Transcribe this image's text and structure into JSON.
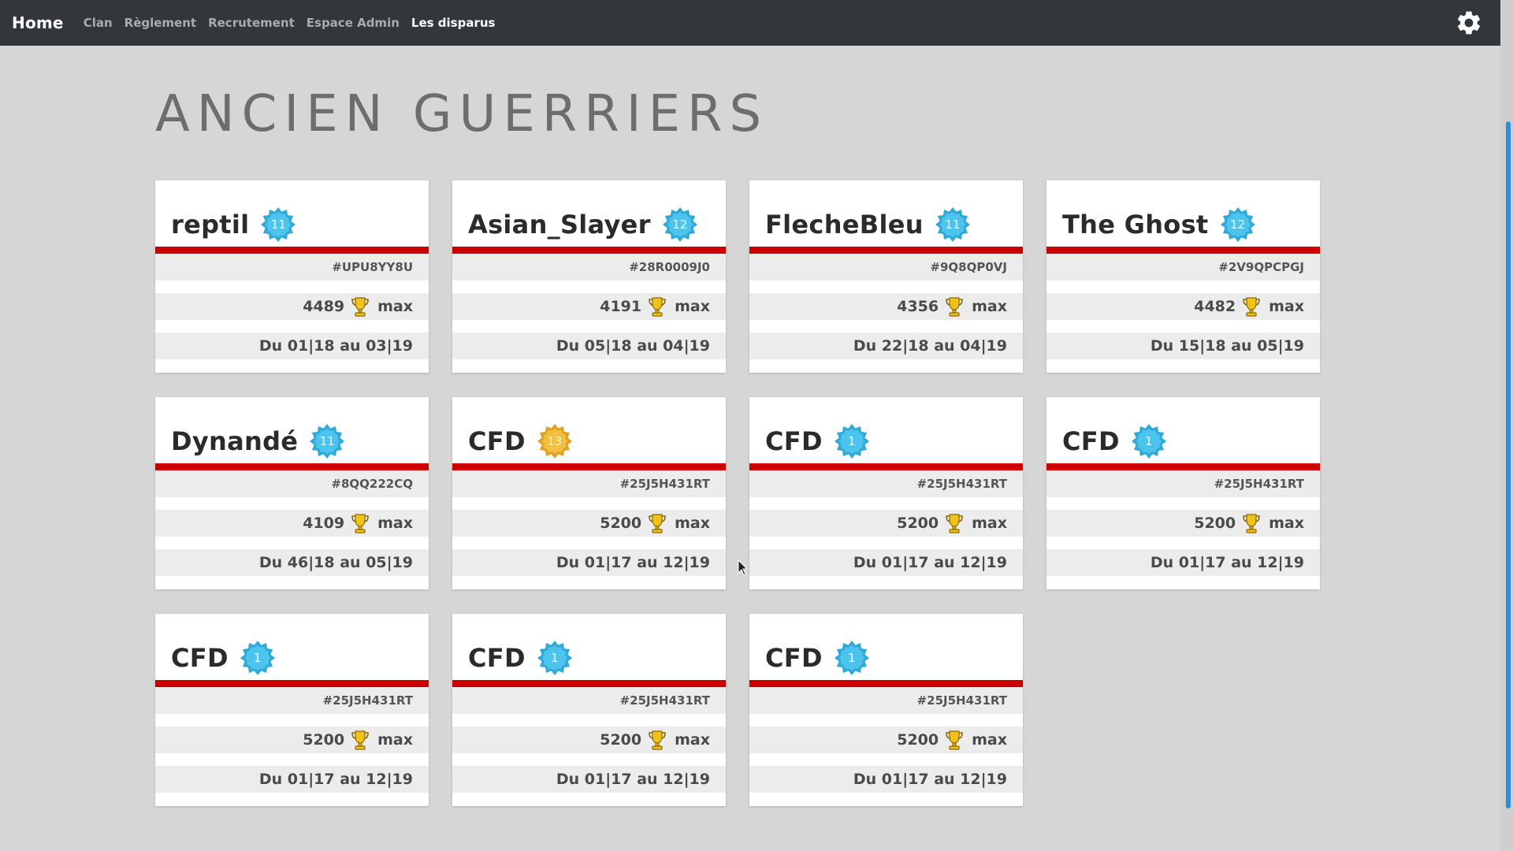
{
  "nav": {
    "brand": "Home",
    "links": [
      {
        "label": "Clan"
      },
      {
        "label": "Règlement"
      },
      {
        "label": "Recrutement"
      },
      {
        "label": "Espace Admin"
      },
      {
        "label": "Les disparus"
      }
    ],
    "settings_icon": "gear-icon"
  },
  "page": {
    "title": "ANCIEN GUERRIERS"
  },
  "colors": {
    "accent": "#cc0000",
    "badge_blue": "#2fa9d6",
    "badge_gold": "#e0a020",
    "navbar": "#33373c"
  },
  "members": [
    {
      "name": "reptil",
      "level": "11",
      "badge": "blue",
      "tag": "#UPU8YY8U",
      "trophies": "4489",
      "max_label": "max",
      "dates": "Du 01|18 au 03|19"
    },
    {
      "name": "Asian_Slayer",
      "level": "12",
      "badge": "blue",
      "tag": "#28R0009J0",
      "trophies": "4191",
      "max_label": "max",
      "dates": "Du 05|18 au 04|19"
    },
    {
      "name": "FlecheBleu",
      "level": "11",
      "badge": "blue",
      "tag": "#9Q8QP0VJ",
      "trophies": "4356",
      "max_label": "max",
      "dates": "Du 22|18 au 04|19"
    },
    {
      "name": "The Ghost",
      "level": "12",
      "badge": "blue",
      "tag": "#2V9QPCPGJ",
      "trophies": "4482",
      "max_label": "max",
      "dates": "Du 15|18 au 05|19"
    },
    {
      "name": "Dynandé",
      "level": "11",
      "badge": "blue",
      "tag": "#8QQ222CQ",
      "trophies": "4109",
      "max_label": "max",
      "dates": "Du 46|18 au 05|19"
    },
    {
      "name": "CFD",
      "level": "13",
      "badge": "gold",
      "tag": "#25J5H431RT",
      "trophies": "5200",
      "max_label": "max",
      "dates": "Du 01|17 au 12|19"
    },
    {
      "name": "CFD",
      "level": "1",
      "badge": "blue",
      "tag": "#25J5H431RT",
      "trophies": "5200",
      "max_label": "max",
      "dates": "Du 01|17 au 12|19"
    },
    {
      "name": "CFD",
      "level": "1",
      "badge": "blue",
      "tag": "#25J5H431RT",
      "trophies": "5200",
      "max_label": "max",
      "dates": "Du 01|17 au 12|19"
    },
    {
      "name": "CFD",
      "level": "1",
      "badge": "blue",
      "tag": "#25J5H431RT",
      "trophies": "5200",
      "max_label": "max",
      "dates": "Du 01|17 au 12|19"
    },
    {
      "name": "CFD",
      "level": "1",
      "badge": "blue",
      "tag": "#25J5H431RT",
      "trophies": "5200",
      "max_label": "max",
      "dates": "Du 01|17 au 12|19"
    },
    {
      "name": "CFD",
      "level": "1",
      "badge": "blue",
      "tag": "#25J5H431RT",
      "trophies": "5200",
      "max_label": "max",
      "dates": "Du 01|17 au 12|19"
    }
  ]
}
